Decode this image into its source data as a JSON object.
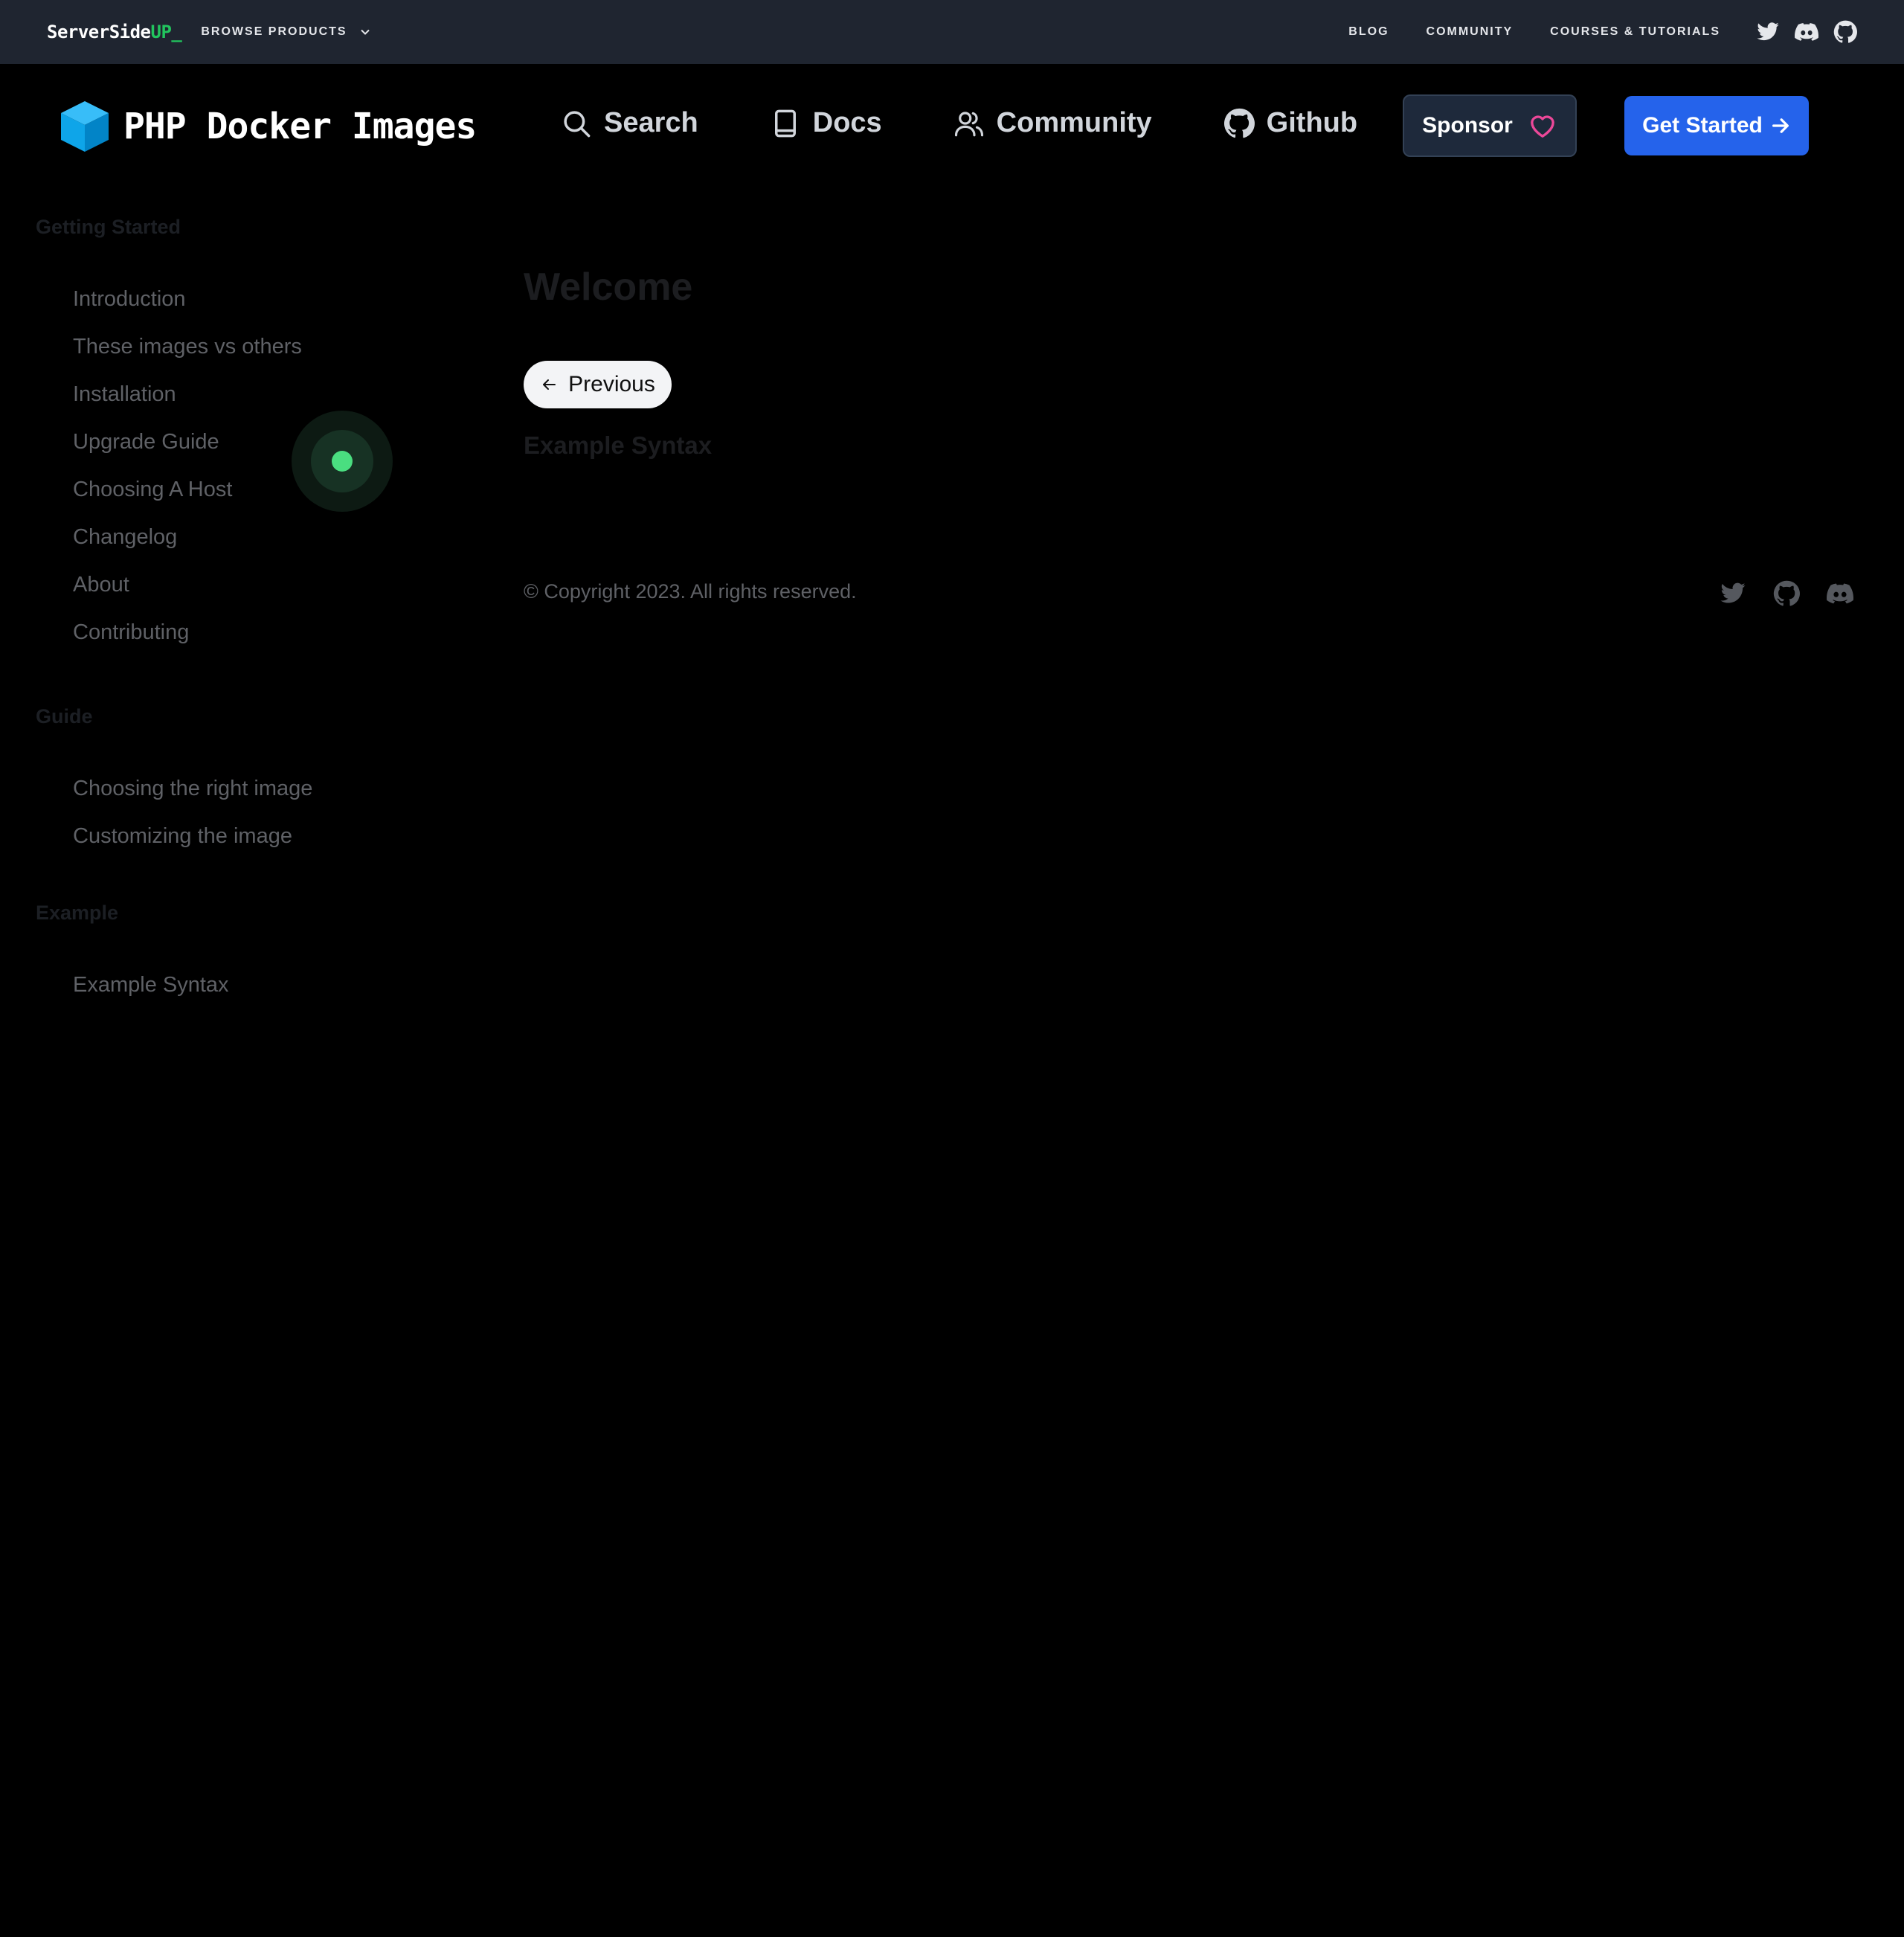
{
  "topbar": {
    "brand_main": "ServerSide",
    "brand_accent": "UP_",
    "browse_label": "BROWSE PRODUCTS",
    "links": [
      "BLOG",
      "COMMUNITY",
      "COURSES & TUTORIALS"
    ],
    "icons": [
      "twitter-icon",
      "discord-icon",
      "github-icon"
    ]
  },
  "header": {
    "logo_text": "PHP Docker Images",
    "nav": {
      "search": "Search",
      "docs": "Docs",
      "community": "Community",
      "github": "Github"
    },
    "sponsor_label": "Sponsor",
    "get_started_label": "Get Started"
  },
  "sidebar": {
    "sections": [
      {
        "title": "Getting Started",
        "items": [
          "Introduction",
          "These images vs others",
          "Installation",
          "Upgrade Guide",
          "Choosing A Host",
          "Changelog",
          "About",
          "Contributing"
        ]
      },
      {
        "title": "Guide",
        "items": [
          "Choosing the right image",
          "Customizing the image"
        ]
      },
      {
        "title": "Example",
        "items": [
          "Example Syntax"
        ]
      }
    ]
  },
  "content": {
    "title": "Welcome",
    "previous_label": "Previous",
    "next_link": "Example Syntax"
  },
  "footer": {
    "copyright": "© Copyright 2023. All rights reserved.",
    "icons": [
      "twitter-icon",
      "github-icon",
      "discord-icon"
    ]
  },
  "colors": {
    "topbar_bg": "#1f2530",
    "brand_accent": "#22c55e",
    "primary_button": "#2563eb",
    "sponsor_heart": "#ec4899",
    "cursor_dot": "#4ade80"
  }
}
